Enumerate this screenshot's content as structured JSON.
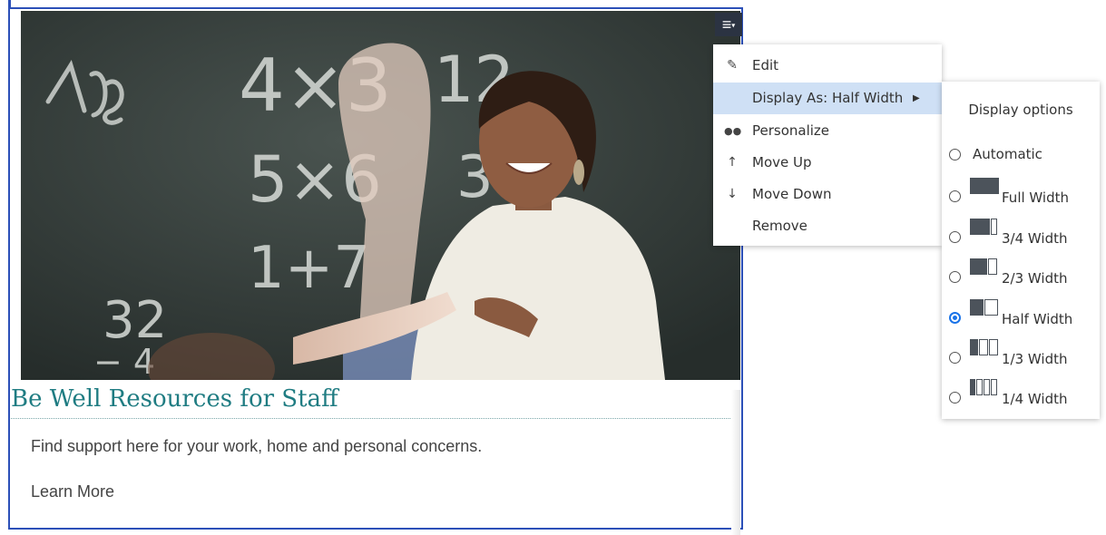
{
  "card": {
    "title": "Be Well Resources for Staff",
    "description": "Find support here for your work, home and personal concerns.",
    "link_label": "Learn More"
  },
  "chalkboard": {
    "lines": [
      "4)8",
      "4 × 3 = 12",
      "5 × 6 = 30",
      "1 + 7 = 8",
      "32",
      "−4"
    ]
  },
  "menu_trigger": {
    "icon": "hamburger-menu-icon"
  },
  "menu": {
    "items": [
      {
        "label": "Edit",
        "icon": "pencil-icon",
        "glyph": "✎"
      },
      {
        "label": "Display As: Half Width",
        "icon": "",
        "glyph": "",
        "has_submenu": true,
        "active": true
      },
      {
        "label": "Personalize",
        "icon": "people-icon",
        "glyph": "👥"
      },
      {
        "label": "Move Up",
        "icon": "arrow-up-icon",
        "glyph": "↑"
      },
      {
        "label": "Move Down",
        "icon": "arrow-down-icon",
        "glyph": "↓"
      },
      {
        "label": "Remove",
        "icon": "",
        "glyph": ""
      }
    ]
  },
  "display_options": {
    "title": "Display options",
    "selected": "Half Width",
    "options": [
      {
        "label": "Automatic"
      },
      {
        "label": "Full Width"
      },
      {
        "label": "3/4 Width"
      },
      {
        "label": "2/3 Width"
      },
      {
        "label": "Half Width"
      },
      {
        "label": "1/3 Width"
      },
      {
        "label": "1/4 Width"
      }
    ]
  },
  "colors": {
    "accent_blue": "#2c50b8",
    "title_teal": "#1f7c82",
    "menu_highlight": "#cfe0f5",
    "radio_selected": "#1a73e8"
  }
}
